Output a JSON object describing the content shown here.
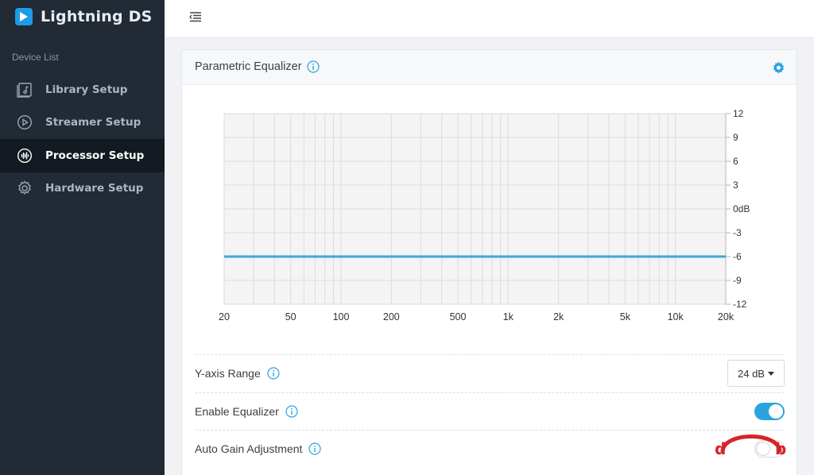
{
  "app": {
    "title": "Lightning DS"
  },
  "sidebar": {
    "section_label": "Device List",
    "items": [
      {
        "label": "Library Setup",
        "icon": "music-library-icon",
        "active": false
      },
      {
        "label": "Streamer Setup",
        "icon": "play-circle-icon",
        "active": false
      },
      {
        "label": "Processor Setup",
        "icon": "waveform-icon",
        "active": true
      },
      {
        "label": "Hardware Setup",
        "icon": "gear-icon",
        "active": false
      }
    ]
  },
  "card": {
    "title": "Parametric Equalizer"
  },
  "chart_data": {
    "type": "line",
    "xscale": "log",
    "xlim": [
      20,
      20000
    ],
    "ylim": [
      -12,
      12
    ],
    "x_ticks": [
      20,
      50,
      100,
      200,
      500,
      1000,
      2000,
      5000,
      10000,
      20000
    ],
    "x_tick_labels": [
      "20",
      "50",
      "100",
      "200",
      "500",
      "1k",
      "2k",
      "5k",
      "10k",
      "20k"
    ],
    "y_ticks": [
      12,
      9,
      6,
      3,
      0,
      -3,
      -6,
      -9,
      -12
    ],
    "y_tick_labels": [
      "12",
      "9",
      "6",
      "3",
      "0dB",
      "-3",
      "-6",
      "-9",
      "-12"
    ],
    "series": [
      {
        "x": [
          20,
          20000
        ],
        "y": [
          -6,
          -6
        ],
        "color": "#3fa7e0"
      }
    ],
    "grid": true,
    "y_axis_side": "right"
  },
  "settings": {
    "yaxis_range": {
      "label": "Y-axis Range",
      "value": "24 dB"
    },
    "enable_equalizer": {
      "label": "Enable Equalizer",
      "on": true
    },
    "auto_gain": {
      "label": "Auto Gain Adjustment",
      "on": false
    }
  },
  "colors": {
    "accent": "#2aa3df",
    "sidebar_bg": "#212a35",
    "line": "#3fa7e0"
  }
}
